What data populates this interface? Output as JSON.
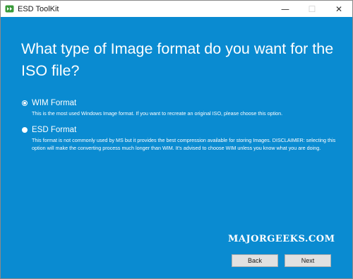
{
  "window": {
    "title": "ESD ToolKit",
    "icon": "esd-toolkit-app-icon",
    "caption": {
      "minimize": "—",
      "maximize": "☐",
      "close": "✕"
    }
  },
  "page": {
    "question": "What type of Image format do you want for the ISO file?",
    "options": [
      {
        "label": "WIM Format",
        "selected": true,
        "description": "This is the most used Windows Image format. If you want to recreate an original ISO, please choose this option."
      },
      {
        "label": "ESD Format",
        "selected": false,
        "description": "This format is not commonly used by MS but it provides the best compression available for storing Images. DISCLAIMER: selecting this option will make the converting process much longer than WIM. It's advised to choose WIM unless you know what you are doing."
      }
    ]
  },
  "watermark": "MAJORGEEKS.COM",
  "buttons": {
    "back": "Back",
    "next": "Next"
  },
  "colors": {
    "background": "#0a8bd1",
    "titlebar": "#ffffff",
    "text": "#ffffff"
  }
}
